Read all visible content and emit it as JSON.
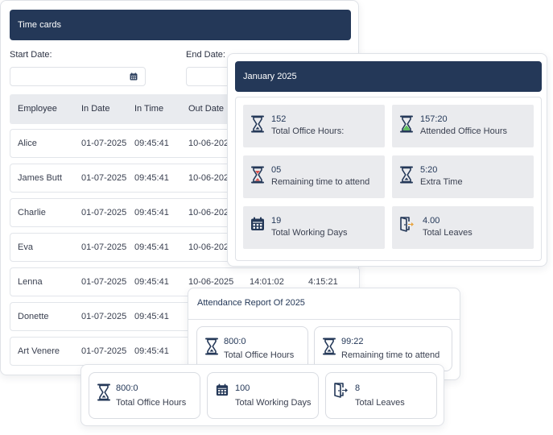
{
  "timecards": {
    "title": "Time cards",
    "start_date_label": "Start Date:",
    "end_date_label": "End Date:",
    "start_date_value": "",
    "end_date_value": "",
    "columns": [
      "Employee",
      "In Date",
      "In Time",
      "Out Date"
    ],
    "rows": [
      {
        "employee": "Alice",
        "in_date": "01-07-2025",
        "in_time": "09:45:41",
        "out_date": "10-06-2025",
        "out_time": "",
        "duration": ""
      },
      {
        "employee": "James Butt",
        "in_date": "01-07-2025",
        "in_time": "09:45:41",
        "out_date": "10-06-2025",
        "out_time": "",
        "duration": ""
      },
      {
        "employee": "Charlie",
        "in_date": "01-07-2025",
        "in_time": "09:45:41",
        "out_date": "10-06-2025",
        "out_time": "",
        "duration": ""
      },
      {
        "employee": "Eva",
        "in_date": "01-07-2025",
        "in_time": "09:45:41",
        "out_date": "10-06-2025",
        "out_time": "",
        "duration": ""
      },
      {
        "employee": "Lenna",
        "in_date": "01-07-2025",
        "in_time": "09:45:41",
        "out_date": "10-06-2025",
        "out_time": "14:01:02",
        "duration": "4:15:21"
      },
      {
        "employee": "Donette",
        "in_date": "01-07-2025",
        "in_time": "09:45:41",
        "out_date": "",
        "out_time": "",
        "duration": ""
      },
      {
        "employee": "Art Venere",
        "in_date": "01-07-2025",
        "in_time": "09:45:41",
        "out_date": "",
        "out_time": "",
        "duration": ""
      }
    ]
  },
  "january": {
    "title": "January 2025",
    "stats": [
      {
        "value": "152",
        "label": "Total Office Hours:",
        "icon": "hourglass-icon"
      },
      {
        "value": "157:20",
        "label": "Attended Office Hours",
        "icon": "hourglass-filled-icon"
      },
      {
        "value": "05",
        "label": "Remaining time to attend",
        "icon": "hourglass-half-icon"
      },
      {
        "value": "5:20",
        "label": "Extra Time",
        "icon": "hourglass-icon"
      },
      {
        "value": "19",
        "label": "Total Working Days",
        "icon": "calendar-icon"
      },
      {
        "value": "4.00",
        "label": "Total Leaves",
        "icon": "exit-door-icon"
      }
    ]
  },
  "attendance": {
    "title": "Attendance Report Of 2025",
    "stats": [
      {
        "value": "800:0",
        "label": "Total Office Hours",
        "icon": "hourglass-icon"
      },
      {
        "value": "99:22",
        "label": "Remaining time to attend",
        "icon": "hourglass-icon"
      }
    ]
  },
  "bottom": {
    "stats": [
      {
        "value": "800:0",
        "label": "Total Office Hours",
        "icon": "hourglass-icon"
      },
      {
        "value": "100",
        "label": "Total Working Days",
        "icon": "calendar-icon"
      },
      {
        "value": "8",
        "label": "Total Leaves",
        "icon": "exit-door-icon"
      }
    ]
  },
  "colors": {
    "header_navy": "#243858",
    "stat_bg": "#eaebee",
    "table_head_bg": "#e9ebef",
    "icon_green": "#5cbf5c",
    "icon_red": "#d9534f",
    "icon_orange": "#e8a33d"
  }
}
